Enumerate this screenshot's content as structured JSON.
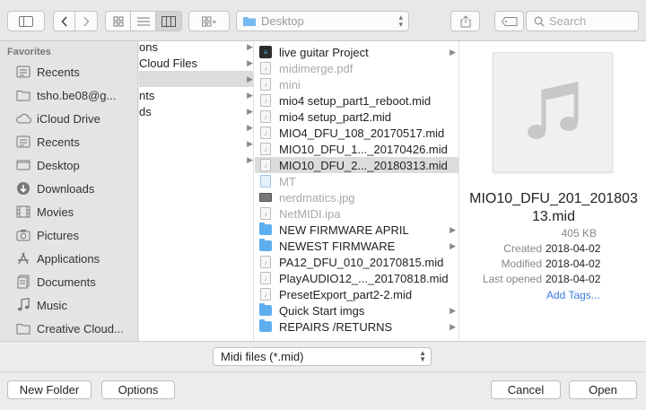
{
  "toolbar": {
    "sidebar_toggle_icon": "sidebar-icon",
    "back_icon": "chevron-left-icon",
    "forward_icon": "chevron-right-icon",
    "view_modes": [
      "icon-view-icon",
      "list-view-icon",
      "column-view-icon"
    ],
    "active_view": "column-view-icon",
    "arrange_icon": "arrange-icon",
    "location": "Desktop",
    "share_icon": "share-icon",
    "tag_icon": "tag-icon",
    "search_placeholder": "Search"
  },
  "sidebar": {
    "heading": "Favorites",
    "items": [
      {
        "label": "Recents",
        "icon": "recents-icon"
      },
      {
        "label": "tsho.be08@g...",
        "icon": "folder-icon"
      },
      {
        "label": "iCloud Drive",
        "icon": "cloud-icon"
      },
      {
        "label": "Recents",
        "icon": "recents-icon"
      },
      {
        "label": "Desktop",
        "icon": "desktop-icon"
      },
      {
        "label": "Downloads",
        "icon": "download-icon"
      },
      {
        "label": "Movies",
        "icon": "film-icon"
      },
      {
        "label": "Pictures",
        "icon": "camera-icon"
      },
      {
        "label": "Applications",
        "icon": "applications-icon"
      },
      {
        "label": "Documents",
        "icon": "documents-icon"
      },
      {
        "label": "Music",
        "icon": "music-icon"
      },
      {
        "label": "Creative Cloud...",
        "icon": "folder-icon"
      }
    ]
  },
  "column1": [
    {
      "label": "ons",
      "arrow": true,
      "selected": false
    },
    {
      "label": "Cloud Files",
      "arrow": true,
      "selected": false
    },
    {
      "label": "",
      "arrow": true,
      "selected": true
    },
    {
      "label": "nts",
      "arrow": true,
      "selected": false
    },
    {
      "label": "ds",
      "arrow": true,
      "selected": false
    },
    {
      "label": "",
      "arrow": true,
      "selected": false
    },
    {
      "label": "",
      "arrow": true,
      "selected": false
    },
    {
      "label": "",
      "arrow": true,
      "selected": false
    }
  ],
  "column2": [
    {
      "label": "live guitar Project",
      "icon": "app",
      "arrow": true,
      "dim": false,
      "selected": false
    },
    {
      "label": "midimerge.pdf",
      "icon": "doc",
      "arrow": false,
      "dim": true,
      "selected": false
    },
    {
      "label": "mini",
      "icon": "doc",
      "arrow": false,
      "dim": true,
      "selected": false
    },
    {
      "label": "mio4 setup_part1_reboot.mid",
      "icon": "doc",
      "arrow": false,
      "dim": false,
      "selected": false
    },
    {
      "label": "mio4 setup_part2.mid",
      "icon": "doc",
      "arrow": false,
      "dim": false,
      "selected": false
    },
    {
      "label": "MIO4_DFU_108_20170517.mid",
      "icon": "doc",
      "arrow": false,
      "dim": false,
      "selected": false
    },
    {
      "label": "MIO10_DFU_1..._20170426.mid",
      "icon": "doc",
      "arrow": false,
      "dim": false,
      "selected": false
    },
    {
      "label": "MIO10_DFU_2..._20180313.mid",
      "icon": "doc",
      "arrow": false,
      "dim": false,
      "selected": true
    },
    {
      "label": "MT",
      "icon": "blue",
      "arrow": false,
      "dim": true,
      "selected": false
    },
    {
      "label": "nerdmatics.jpg",
      "icon": "img",
      "arrow": false,
      "dim": true,
      "selected": false
    },
    {
      "label": "NetMIDI.ipa",
      "icon": "doc",
      "arrow": false,
      "dim": true,
      "selected": false
    },
    {
      "label": "NEW FIRMWARE APRIL",
      "icon": "folder",
      "arrow": true,
      "dim": false,
      "selected": false
    },
    {
      "label": "NEWEST FIRMWARE",
      "icon": "folder",
      "arrow": true,
      "dim": false,
      "selected": false
    },
    {
      "label": "PA12_DFU_010_20170815.mid",
      "icon": "doc",
      "arrow": false,
      "dim": false,
      "selected": false
    },
    {
      "label": "PlayAUDIO12_..._20170818.mid",
      "icon": "doc",
      "arrow": false,
      "dim": false,
      "selected": false
    },
    {
      "label": "PresetExport_part2-2.mid",
      "icon": "doc",
      "arrow": false,
      "dim": false,
      "selected": false
    },
    {
      "label": "Quick Start imgs",
      "icon": "folder",
      "arrow": true,
      "dim": false,
      "selected": false
    },
    {
      "label": "REPAIRS /RETURNS",
      "icon": "folder",
      "arrow": true,
      "dim": false,
      "selected": false
    }
  ],
  "preview": {
    "thumbnail_icon": "music-note-icon",
    "name": "MIO10_DFU_201_20180313.mid",
    "size": "405 KB",
    "meta": [
      {
        "key": "Created",
        "value": "2018-04-02"
      },
      {
        "key": "Modified",
        "value": "2018-04-02"
      },
      {
        "key": "Last opened",
        "value": "2018-04-02"
      }
    ],
    "add_tags": "Add Tags..."
  },
  "filter": {
    "selected": "Midi files (*.mid)"
  },
  "buttons": {
    "new_folder": "New Folder",
    "options": "Options",
    "cancel": "Cancel",
    "open": "Open"
  }
}
